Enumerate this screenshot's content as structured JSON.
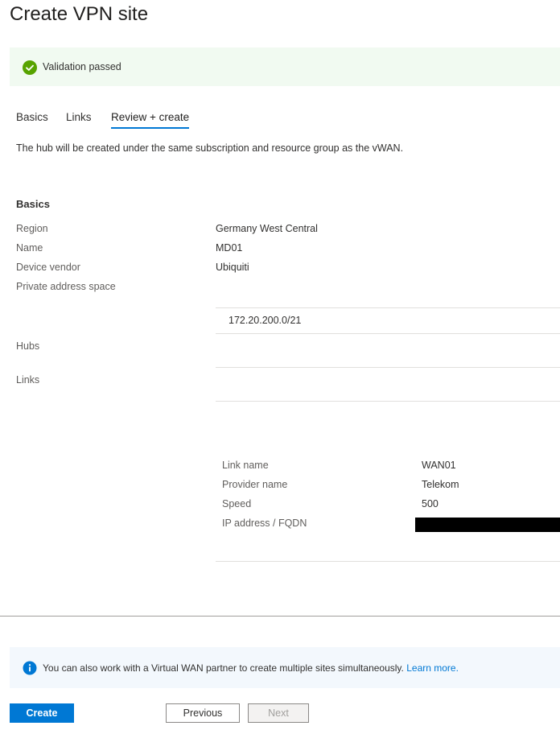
{
  "page": {
    "title": "Create VPN site"
  },
  "validation": {
    "message": "Validation passed",
    "color": "#57a300"
  },
  "tabs": [
    {
      "label": "Basics",
      "active": false
    },
    {
      "label": "Links",
      "active": false
    },
    {
      "label": "Review + create",
      "active": true
    }
  ],
  "intro": "The hub will be created under the same subscription and resource group as the vWAN.",
  "basics": {
    "heading": "Basics",
    "region_label": "Region",
    "region_value": "Germany West Central",
    "name_label": "Name",
    "name_value": "MD01",
    "vendor_label": "Device vendor",
    "vendor_value": "Ubiquiti",
    "address_space_label": "Private address space",
    "address_space_value": "172.20.200.0/21",
    "hubs_label": "Hubs",
    "links_label": "Links"
  },
  "link": {
    "name_label": "Link name",
    "name_value": "WAN01",
    "provider_label": "Provider name",
    "provider_value": "Telekom",
    "speed_label": "Speed",
    "speed_value": "500",
    "ip_label": "IP address / FQDN"
  },
  "info": {
    "message": "You can also work with a Virtual WAN partner to create multiple sites simultaneously.",
    "link_text": "Learn more."
  },
  "buttons": {
    "create": "Create",
    "previous": "Previous",
    "next": "Next"
  },
  "colors": {
    "accent": "#0078d4",
    "success_bg": "#f1faf1",
    "info_bg": "#f3f8fd"
  }
}
